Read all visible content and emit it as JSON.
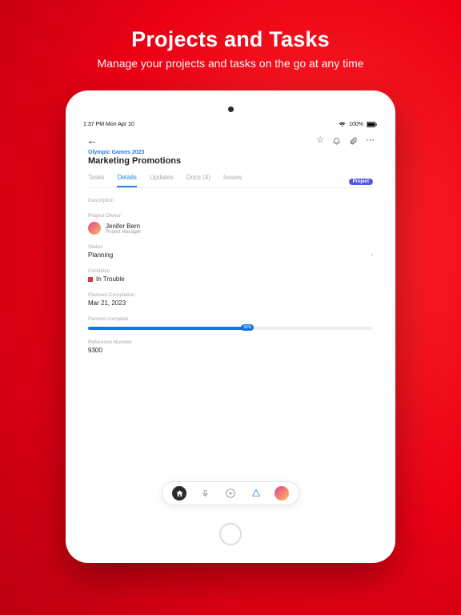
{
  "hero": {
    "title": "Projects and Tasks",
    "subtitle": "Manage your projects and tasks  on the go at any time"
  },
  "status": {
    "time": "1:37 PM  Mon Apr 10",
    "battery": "100%"
  },
  "topbar": {
    "star": "☆",
    "bell": "△",
    "clip": "⚲",
    "more": "⋯"
  },
  "breadcrumb": "Olympic Games 2023",
  "page_title": "Marketing Promotions",
  "badge": "Project",
  "tabs": [
    {
      "label": "Tasks"
    },
    {
      "label": "Details"
    },
    {
      "label": "Updates"
    },
    {
      "label": "Docs (4)"
    },
    {
      "label": "Issues"
    }
  ],
  "labels": {
    "description": "Description",
    "owner": "Project Owner",
    "status": "Status",
    "condition": "Condition",
    "planned": "Planned Completion",
    "percent": "Percent complete",
    "ref": "Reference Number"
  },
  "owner": {
    "name": "Jenifer Bern",
    "role": "Project Manager"
  },
  "status_value": "Planning",
  "condition_value": "In Trouble",
  "planned_value": "Mar 21, 2023",
  "percent_value": 56,
  "percent_label": "56%",
  "ref_value": "9300",
  "dock": {
    "home": "⌂",
    "mic": "◡",
    "plus": "⊕",
    "tri": "△"
  }
}
